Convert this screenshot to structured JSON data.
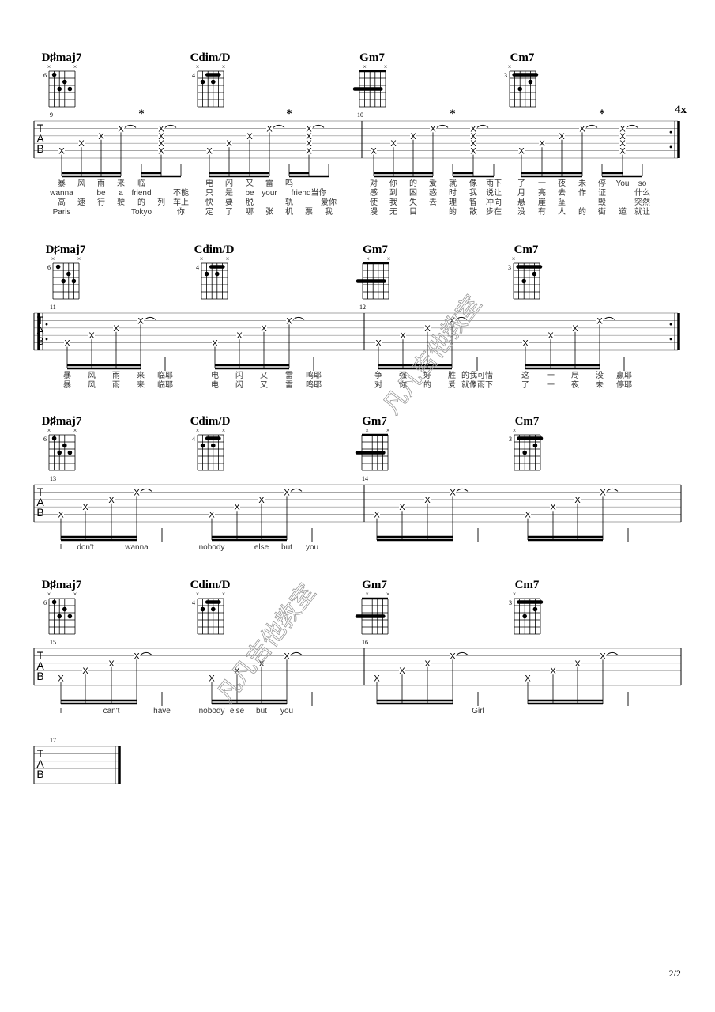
{
  "page_number": "2/2",
  "watermark": "凡凡吉他教室",
  "repeat_count": "4x",
  "tab_clef": [
    "T",
    "A",
    "B"
  ],
  "note_glyph": "X",
  "accent_mark": "*",
  "chord_diagrams": [
    {
      "name": "D♯maj7",
      "fret": "6",
      "mutes": [
        6,
        1
      ],
      "barre": null,
      "dots": [
        [
          5,
          1
        ],
        [
          3,
          2
        ],
        [
          4,
          3
        ],
        [
          2,
          3
        ]
      ],
      "nut": false
    },
    {
      "name": "Cdim/D",
      "fret": "4",
      "mutes": [
        6,
        1
      ],
      "barre": {
        "fret": 1,
        "from": 4,
        "to": 2
      },
      "dots": [
        [
          5,
          2
        ],
        [
          3,
          2
        ]
      ],
      "nut": false
    },
    {
      "name": "Gm7",
      "fret": "",
      "mutes": [
        5,
        1
      ],
      "barre": {
        "fret": 3,
        "from": 6,
        "to": 2
      },
      "dots": [],
      "nut": true
    },
    {
      "name": "Cm7",
      "fret": "3",
      "mutes": [
        6
      ],
      "barre": {
        "fret": 1,
        "from": 5,
        "to": 1
      },
      "dots": [
        [
          4,
          3
        ],
        [
          2,
          2
        ]
      ],
      "nut": false
    }
  ],
  "systems": [
    {
      "chords": [
        "D♯maj7",
        "Cdim/D",
        "Gm7",
        "Cm7"
      ],
      "measures": [
        {
          "number": "9",
          "lyrics": [
            [
              "暴",
              "风",
              "雨",
              "来",
              "临",
              "",
              "",
              "电",
              "闪",
              "又",
              "雷",
              "鸣",
              "",
              ""
            ],
            [
              "wanna",
              "",
              "be",
              "a",
              "friend",
              "",
              "不能",
              "只",
              "是",
              "be",
              "your",
              "",
              "friend当你",
              ""
            ],
            [
              "高",
              "速",
              "行",
              "驶",
              "的",
              "列",
              "车上",
              "快",
              "要",
              "脱",
              "",
              "轨",
              "",
              "爱你"
            ],
            [
              "Paris",
              "",
              "",
              "",
              "Tokyo",
              "",
              "你",
              "定",
              "了",
              "哪",
              "张",
              "机",
              "票",
              "我"
            ]
          ]
        },
        {
          "number": "10",
          "lyrics": [
            [
              "对",
              "你",
              "的",
              "爱",
              "就",
              "像",
              "雨下",
              "了",
              "一",
              "夜",
              "未",
              "停",
              "You",
              "so"
            ],
            [
              "感",
              "到",
              "困",
              "惑",
              "时",
              "我",
              "说让",
              "月",
              "亮",
              "去",
              "作",
              "证",
              "",
              "什么"
            ],
            [
              "使",
              "我",
              "失",
              "去",
              "理",
              "智",
              "冲向",
              "悬",
              "崖",
              "坠",
              "",
              "毁",
              "",
              "突然"
            ],
            [
              "漫",
              "无",
              "目",
              "",
              "的",
              "散",
              "步在",
              "没",
              "有",
              "人",
              "的",
              "街",
              "道",
              "就让"
            ]
          ]
        }
      ]
    },
    {
      "chords": [
        "D♯maj7",
        "Cdim/D",
        "Gm7",
        "Cm7"
      ],
      "measures": [
        {
          "number": "11",
          "lyrics": [
            [
              "暴",
              "风",
              "雨",
              "来",
              "临耶",
              "电",
              "闪",
              "又",
              "雷",
              "鸣耶"
            ],
            [
              "暴",
              "风",
              "雨",
              "来",
              "临耶",
              "电",
              "闪",
              "又",
              "雷",
              "鸣耶"
            ]
          ]
        },
        {
          "number": "12",
          "lyrics": [
            [
              "争",
              "强",
              "好",
              "胜",
              "的我可惜",
              "这",
              "一",
              "局",
              "没",
              "赢耶"
            ],
            [
              "对",
              "你",
              "的",
              "爱",
              "就像雨下",
              "了",
              "一",
              "夜",
              "未",
              "停耶"
            ]
          ]
        }
      ]
    },
    {
      "chords": [
        "D♯maj7",
        "Cdim/D",
        "Gm7",
        "Cm7"
      ],
      "measures": [
        {
          "number": "13",
          "lyrics": [
            [
              "I",
              "don't",
              "",
              "wanna",
              "",
              "nobody",
              "",
              "else",
              "but",
              "you"
            ]
          ]
        },
        {
          "number": "14",
          "lyrics": []
        }
      ]
    },
    {
      "chords": [
        "D♯maj7",
        "Cdim/D",
        "Gm7",
        "Cm7"
      ],
      "measures": [
        {
          "number": "15",
          "lyrics": [
            [
              "I",
              "",
              "can't",
              "",
              "have",
              "nobody",
              "else",
              "but",
              "you",
              ""
            ]
          ]
        },
        {
          "number": "16",
          "lyrics": [
            [
              "",
              "",
              "",
              "",
              "Girl",
              "",
              "",
              "",
              "",
              ""
            ]
          ]
        }
      ]
    },
    {
      "chords": [],
      "measures": [
        {
          "number": "17",
          "lyrics": []
        }
      ]
    }
  ]
}
